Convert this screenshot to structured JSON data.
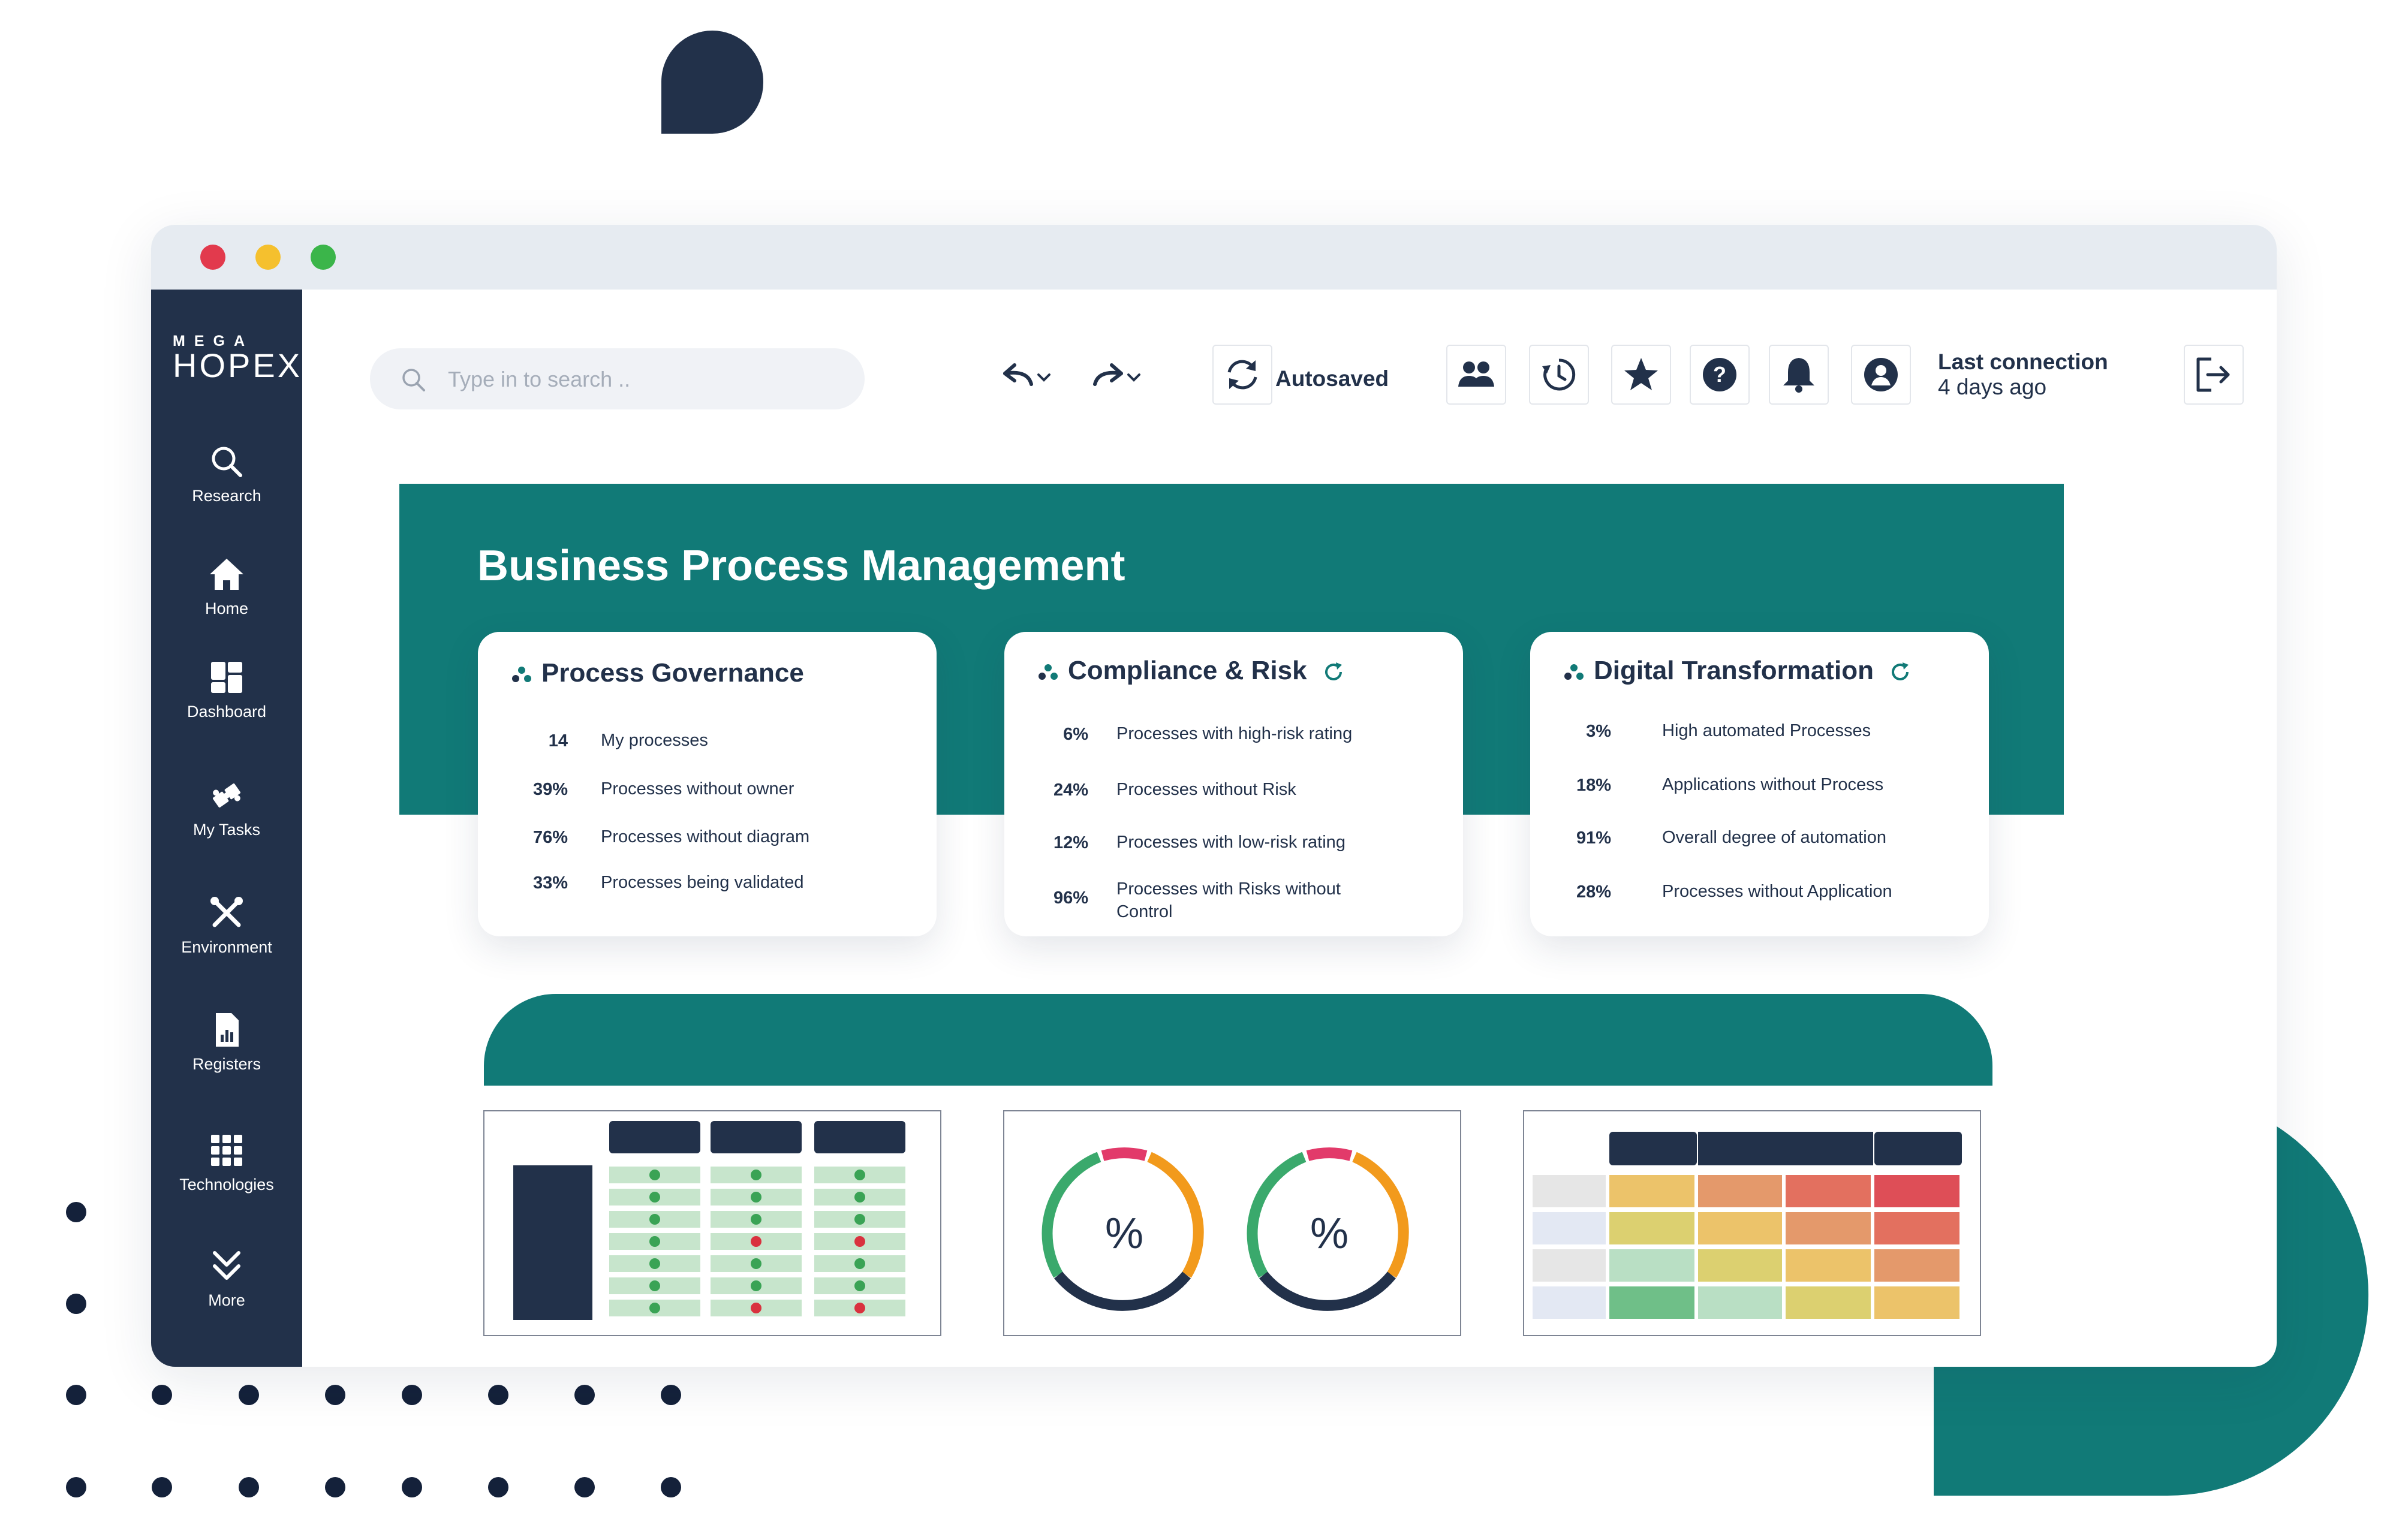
{
  "brand": {
    "logo_small": "MEGA",
    "logo_big": "HOPEX"
  },
  "sidebar": {
    "items": [
      {
        "label": "Research",
        "icon": "search-icon"
      },
      {
        "label": "Home",
        "icon": "home-icon"
      },
      {
        "label": "Dashboard",
        "icon": "dashboard-icon"
      },
      {
        "label": "My Tasks",
        "icon": "puzzle-icon"
      },
      {
        "label": "Environment",
        "icon": "tools-icon"
      },
      {
        "label": "Registers",
        "icon": "report-icon"
      },
      {
        "label": "Technologies",
        "icon": "grid-icon"
      },
      {
        "label": "More",
        "icon": "chevron-double-down-icon"
      }
    ]
  },
  "toolbar": {
    "search_placeholder": "Type in to search ..",
    "autosaved_label": "Autosaved",
    "last_connection_title": "Last connection",
    "last_connection_value": "4 days ago"
  },
  "main": {
    "title": "Business Process Management",
    "cards": [
      {
        "title": "Process Governance",
        "metrics": [
          {
            "value": "14",
            "label": "My processes"
          },
          {
            "value": "39%",
            "label": "Processes without owner"
          },
          {
            "value": "76%",
            "label": "Processes without diagram"
          },
          {
            "value": "33%",
            "label": "Processes being validated"
          }
        ]
      },
      {
        "title": "Compliance & Risk",
        "metrics": [
          {
            "value": "6%",
            "label": "Processes with high-risk rating"
          },
          {
            "value": "24%",
            "label": "Processes without Risk"
          },
          {
            "value": "12%",
            "label": "Processes with low-risk rating"
          },
          {
            "value": "96%",
            "label": "Processes with Risks without Control"
          }
        ]
      },
      {
        "title": "Digital Transformation",
        "metrics": [
          {
            "value": "3%",
            "label": "High automated Processes"
          },
          {
            "value": "18%",
            "label": "Applications without Process"
          },
          {
            "value": "91%",
            "label": "Overall degree of automation"
          },
          {
            "value": "28%",
            "label": "Processes without Application"
          }
        ]
      }
    ],
    "gauges": [
      {
        "symbol": "%"
      },
      {
        "symbol": "%"
      }
    ]
  },
  "colors": {
    "teal": "#117a77",
    "navy": "#22314a",
    "gauge_green": "#3aa96c",
    "gauge_pink": "#e23a6a",
    "gauge_orange": "#f29a1c",
    "check_green": "#3aa355",
    "cross_red": "#d9323e"
  }
}
